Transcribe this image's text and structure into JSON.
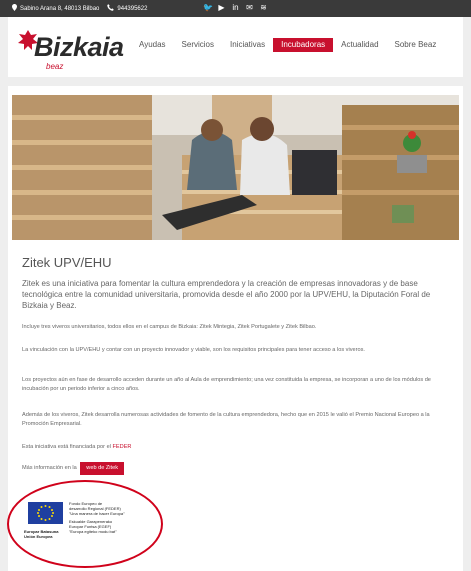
{
  "topbar": {
    "address": "Sabino Arana 8, 48013 Bilbao",
    "phone": "944395622",
    "social_icons": [
      "twitter-icon",
      "youtube-icon",
      "linkedin-icon",
      "email-icon",
      "rss-icon"
    ],
    "social_glyphs": [
      "🐦",
      "▶",
      "in",
      "✉",
      "≋"
    ]
  },
  "logo": {
    "word": "Bizkaia",
    "sub": "beaz"
  },
  "nav": {
    "items": [
      "Ayudas",
      "Servicios",
      "Iniciativas",
      "Incubadoras",
      "Actualidad",
      "Sobre Beaz"
    ],
    "active_index": 3
  },
  "page": {
    "title": "Zitek UPV/EHU",
    "lead": "Zitek es una iniciativa para fomentar la cultura emprendedora y la creación de empresas innovadoras y de base tecnológica entre la comunidad universitaria, promovida desde el año 2000 por la UPV/EHU, la Diputación Foral de Bizkaia y Beaz.",
    "p1": "Incluye tres viveros universitarios, todos ellos en el campus de Bizkaia: Zitek Mintegia, Zitek Portugalete y Zitek Bilbao.",
    "p2": "La vinculación con la UPV/EHU y contar con un proyecto innovador y viable, son los requisitos principales para tener acceso a los viveros.",
    "p3": "Los proyectos aún en fase de desarrollo acceden durante un año al Aula de emprendimiento; una vez constituida la empresa, se incorporan a uno de los módulos de incubación por un periodo inferior a cinco años.",
    "p4": "Además de los viveros, Zitek desarrolla numerosas actividades de fomento de la cultura emprendedora, hecho que en 2015 le valió el Premio Nacional Europeo a la Promoción Empresarial.",
    "feder_prefix": "Esta iniciativa está financiada por el",
    "feder_link": "FEDER",
    "more_prefix": "Más información en la",
    "more_button": "web de Zitek"
  },
  "eu": {
    "union_label": "Europar Batasuna\nUnión Europea",
    "feder_text": "Fondo Europeo de\ndesarrollo Regional (FEDER)\n\"Una manera de hacer Europa\"",
    "egef_text": "Eskualde Garapenerako\nEuropar Funtsa (EGEF)\n\"Europa egiteko modu bat\""
  },
  "colors": {
    "accent": "#c8102e",
    "topbar": "#3a3a3a",
    "eu_blue": "#1f3fa0",
    "eu_star": "#ffdd00"
  }
}
